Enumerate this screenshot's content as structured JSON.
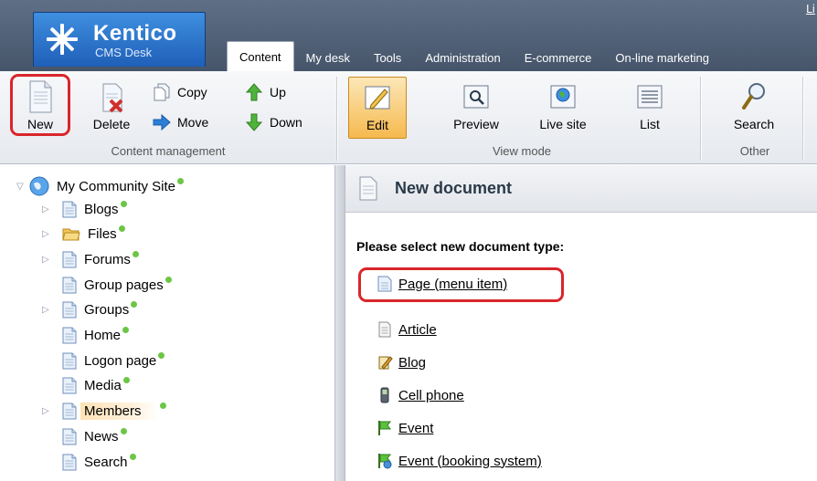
{
  "header": {
    "logo_name": "Kentico",
    "logo_sub": "CMS Desk",
    "top_link": "Li",
    "tabs": [
      {
        "label": "Content",
        "active": true
      },
      {
        "label": "My desk"
      },
      {
        "label": "Tools"
      },
      {
        "label": "Administration"
      },
      {
        "label": "E-commerce"
      },
      {
        "label": "On-line marketing"
      }
    ]
  },
  "ribbon": {
    "groups": {
      "content_management": "Content management",
      "view_mode": "View mode",
      "other": "Other"
    },
    "buttons": {
      "new": "New",
      "delete": "Delete",
      "copy": "Copy",
      "move": "Move",
      "up": "Up",
      "down": "Down",
      "edit": "Edit",
      "preview": "Preview",
      "live_site": "Live site",
      "list": "List",
      "search": "Search"
    },
    "active_view_mode": "Edit"
  },
  "tree": {
    "root": "My Community Site",
    "items": [
      {
        "label": "Blogs",
        "expandable": true,
        "icon": "page-icon"
      },
      {
        "label": "Files",
        "expandable": true,
        "icon": "folder-icon"
      },
      {
        "label": "Forums",
        "expandable": true,
        "icon": "page-icon"
      },
      {
        "label": "Group pages",
        "expandable": false,
        "icon": "page-icon"
      },
      {
        "label": "Groups",
        "expandable": true,
        "icon": "page-icon"
      },
      {
        "label": "Home",
        "expandable": false,
        "icon": "page-icon"
      },
      {
        "label": "Logon page",
        "expandable": false,
        "icon": "page-icon"
      },
      {
        "label": "Media",
        "expandable": false,
        "icon": "page-icon"
      },
      {
        "label": "Members",
        "expandable": true,
        "icon": "page-icon",
        "selected": true
      },
      {
        "label": "News",
        "expandable": false,
        "icon": "page-icon"
      },
      {
        "label": "Search",
        "expandable": false,
        "icon": "page-icon"
      }
    ]
  },
  "content": {
    "title": "New document",
    "prompt": "Please select new document type:",
    "doc_types": [
      {
        "label": "Page (menu item)",
        "icon": "page-icon"
      },
      {
        "label": "Article",
        "icon": "article-icon"
      },
      {
        "label": "Blog",
        "icon": "blog-icon"
      },
      {
        "label": "Cell phone",
        "icon": "cell-phone-icon"
      },
      {
        "label": "Event",
        "icon": "flag-icon"
      },
      {
        "label": "Event (booking system)",
        "icon": "flag-booking-icon"
      }
    ]
  },
  "colors": {
    "header_bg": "#505e73",
    "logo_bg": "#2e75cc",
    "status_dot": "#6cc644",
    "highlight_ring": "#d9262b",
    "active_button": "#f6b94e"
  }
}
